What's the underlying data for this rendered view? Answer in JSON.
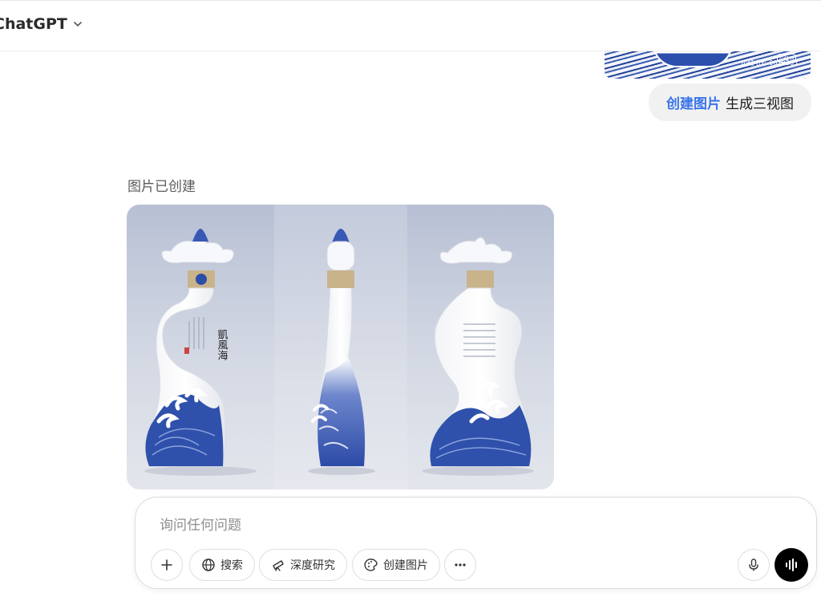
{
  "header": {
    "model_label": "ChatGPT"
  },
  "previous_image": {
    "watermark": "小红书号:9629285",
    "badge": "小红书"
  },
  "user_message": {
    "tool_tag": "创建图片",
    "text": "生成三视图"
  },
  "assistant": {
    "status": "图片已创建",
    "image": {
      "description_label": "three-view-bottle-render",
      "bottle_calligraphy": "凱風海"
    }
  },
  "composer": {
    "placeholder": "询问任何问题",
    "tools": {
      "add_label": "+",
      "search_label": "搜索",
      "deep_research_label": "深度研究",
      "create_image_label": "创建图片",
      "more_label": "•••"
    }
  },
  "colors": {
    "accent": "#3a74ea",
    "porcelain_blue": "#2c4fae",
    "bubble_bg": "#f1f1f1"
  }
}
